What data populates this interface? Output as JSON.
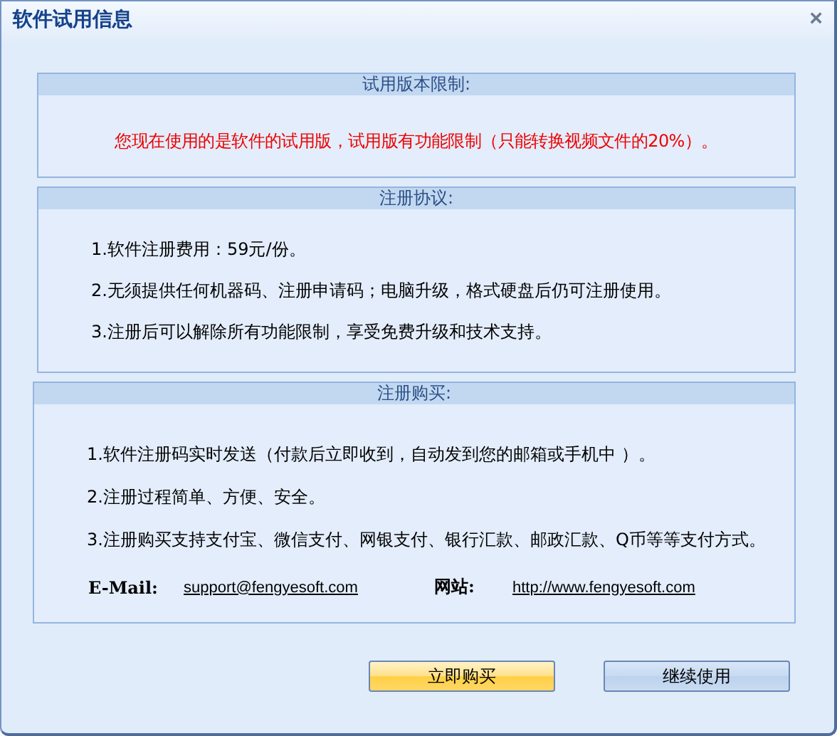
{
  "window": {
    "title": "软件试用信息",
    "close": "×"
  },
  "trial_panel": {
    "title": "试用版本限制:",
    "notice": "您现在使用的是软件的试用版，试用版有功能限制（只能转换视频文件的20%）。"
  },
  "agreement_panel": {
    "title": "注册协议:",
    "items": [
      "1.软件注册费用：59元/份。",
      "2.无须提供任何机器码、注册申请码；电脑升级，格式硬盘后仍可注册使用。",
      "3.注册后可以解除所有功能限制，享受免费升级和技术支持。"
    ]
  },
  "purchase_panel": {
    "title": "注册购买:",
    "items": [
      "1.软件注册码实时发送（付款后立即收到，自动发到您的邮箱或手机中 ）。",
      "2.注册过程简单、方便、安全。",
      "3.注册购买支持支付宝、微信支付、网银支付、银行汇款、邮政汇款、Q币等等支付方式。"
    ],
    "contacts": [
      {
        "label": "E-Mail:",
        "value": "support@fengyesoft.com"
      },
      {
        "label": "网站:",
        "value": "http://www.fengyesoft.com"
      }
    ]
  },
  "buttons": [
    {
      "label": "立即购买",
      "kind": "primary"
    },
    {
      "label": "继续使用",
      "kind": "secondary"
    }
  ]
}
